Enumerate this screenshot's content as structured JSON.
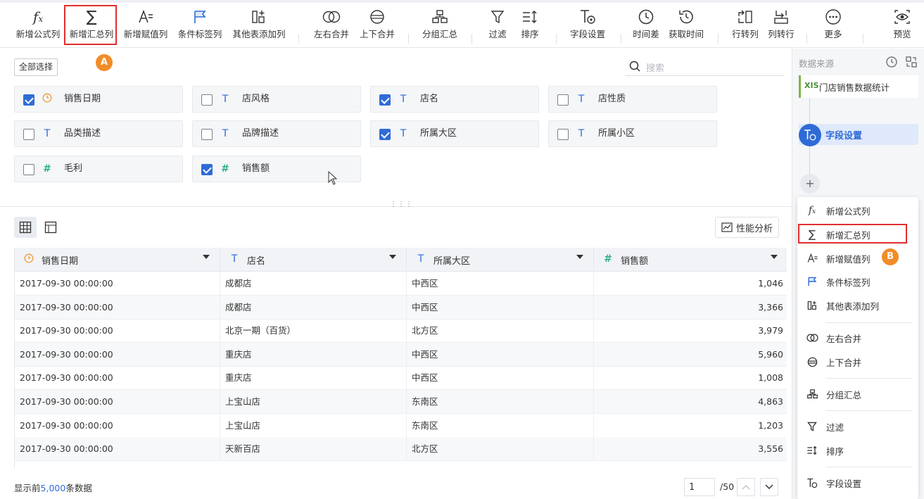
{
  "toolbar": {
    "items": [
      {
        "label": "新增公式列",
        "icon": "formula-icon"
      },
      {
        "label": "新增汇总列",
        "icon": "sigma-icon"
      },
      {
        "label": "新增赋值列",
        "icon": "assign-icon"
      },
      {
        "label": "条件标签列",
        "icon": "flag-icon"
      },
      {
        "label": "其他表添加列",
        "icon": "add-column-icon"
      },
      {
        "label": "左右合并",
        "icon": "horizontal-merge-icon"
      },
      {
        "label": "上下合并",
        "icon": "vertical-merge-icon"
      },
      {
        "label": "分组汇总",
        "icon": "group-summary-icon"
      },
      {
        "label": "过滤",
        "icon": "filter-icon"
      },
      {
        "label": "排序",
        "icon": "sort-icon"
      },
      {
        "label": "字段设置",
        "icon": "field-settings-icon"
      },
      {
        "label": "时间差",
        "icon": "time-diff-icon"
      },
      {
        "label": "获取时间",
        "icon": "get-time-icon"
      },
      {
        "label": "行转列",
        "icon": "row-to-column-icon"
      },
      {
        "label": "列转行",
        "icon": "column-to-row-icon"
      },
      {
        "label": "更多",
        "icon": "more-icon"
      },
      {
        "label": "预览",
        "icon": "preview-icon"
      }
    ]
  },
  "badges": {
    "a": "A",
    "b": "B"
  },
  "fields_panel": {
    "select_all_label": "全部选择",
    "search_placeholder": "搜索",
    "fields": [
      {
        "name": "销售日期",
        "type": "date",
        "checked": true
      },
      {
        "name": "店风格",
        "type": "text",
        "checked": false
      },
      {
        "name": "店名",
        "type": "text",
        "checked": true
      },
      {
        "name": "店性质",
        "type": "text",
        "checked": false
      },
      {
        "name": "品类描述",
        "type": "text",
        "checked": false
      },
      {
        "name": "品牌描述",
        "type": "text",
        "checked": false
      },
      {
        "name": "所属大区",
        "type": "text",
        "checked": true
      },
      {
        "name": "所属小区",
        "type": "text",
        "checked": false
      },
      {
        "name": "毛利",
        "type": "number",
        "checked": false
      },
      {
        "name": "销售额",
        "type": "number",
        "checked": true
      }
    ]
  },
  "preview": {
    "perf_button_label": "性能分析",
    "columns": [
      {
        "name": "销售日期",
        "type": "date"
      },
      {
        "name": "店名",
        "type": "text"
      },
      {
        "name": "所属大区",
        "type": "text"
      },
      {
        "name": "销售额",
        "type": "number"
      }
    ],
    "rows": [
      [
        "2017-09-30 00:00:00",
        "成都店",
        "中西区",
        "1,046"
      ],
      [
        "2017-09-30 00:00:00",
        "成都店",
        "中西区",
        "3,366"
      ],
      [
        "2017-09-30 00:00:00",
        "北京一期（百货）",
        "北方区",
        "3,979"
      ],
      [
        "2017-09-30 00:00:00",
        "重庆店",
        "中西区",
        "5,960"
      ],
      [
        "2017-09-30 00:00:00",
        "重庆店",
        "中西区",
        "1,008"
      ],
      [
        "2017-09-30 00:00:00",
        "上宝山店",
        "东南区",
        "4,863"
      ],
      [
        "2017-09-30 00:00:00",
        "上宝山店",
        "东南区",
        "1,203"
      ],
      [
        "2017-09-30 00:00:00",
        "天新百店",
        "北方区",
        "3,556"
      ]
    ],
    "footer": {
      "prefix": "显示前",
      "count": "5,000",
      "suffix": "条数据"
    },
    "pagination": {
      "current": "1",
      "total": "/50"
    }
  },
  "right_panel": {
    "title": "数据来源",
    "source_icon_text": "XIS",
    "source_name": "门店销售数据统计",
    "step_label": "字段设置",
    "add_symbol": "+",
    "menu": [
      {
        "label": "新增公式列",
        "icon": "formula-icon"
      },
      {
        "label": "新增汇总列",
        "icon": "sigma-icon"
      },
      {
        "label": "新增赋值列",
        "icon": "assign-icon"
      },
      {
        "label": "条件标签列",
        "icon": "flag-icon"
      },
      {
        "label": "其他表添加列",
        "icon": "add-column-icon"
      },
      {
        "label": "左右合并",
        "icon": "horizontal-merge-icon"
      },
      {
        "label": "上下合并",
        "icon": "vertical-merge-icon"
      },
      {
        "label": "分组汇总",
        "icon": "group-summary-icon"
      },
      {
        "label": "过滤",
        "icon": "filter-icon"
      },
      {
        "label": "排序",
        "icon": "sort-icon"
      },
      {
        "label": "字段设置",
        "icon": "field-settings-icon"
      }
    ]
  },
  "colors": {
    "accent": "#2f6bd7",
    "highlight": "#e02e2e",
    "badge": "#f28c28"
  }
}
